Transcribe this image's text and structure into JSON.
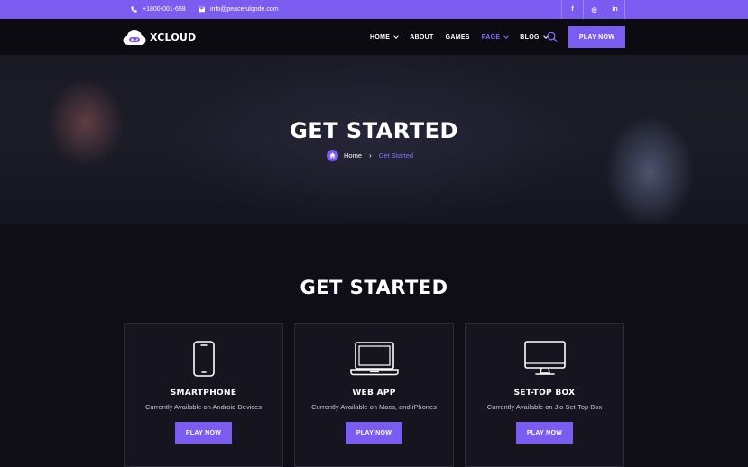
{
  "topbar": {
    "phone": "+1800-001-658",
    "email": "info@peacefulqode.com",
    "socials": [
      {
        "icon": "facebook-icon",
        "glyph": "f"
      },
      {
        "icon": "instagram-icon",
        "glyph": "◎"
      },
      {
        "icon": "linkedin-icon",
        "glyph": "in"
      }
    ]
  },
  "header": {
    "logo": "XCLOUD",
    "nav": [
      {
        "label": "HOME",
        "dropdown": true,
        "active": false
      },
      {
        "label": "ABOUT",
        "dropdown": false,
        "active": false
      },
      {
        "label": "GAMES",
        "dropdown": false,
        "active": false
      },
      {
        "label": "PAGE",
        "dropdown": true,
        "active": true
      },
      {
        "label": "BLOG",
        "dropdown": true,
        "active": false
      }
    ],
    "cta": "PLAY NOW"
  },
  "hero": {
    "title": "GET STARTED",
    "breadcrumb_home": "Home",
    "breadcrumb_current": "Get Started"
  },
  "section": {
    "title": "GET STARTED",
    "cards": [
      {
        "title": "SMARTPHONE",
        "desc": "Currently Available on Android Devices",
        "button": "PLAY NOW",
        "icon": "smartphone-icon"
      },
      {
        "title": "WEB APP",
        "desc": "Currently Available on Macs, and iPhones",
        "button": "PLAY NOW",
        "icon": "laptop-icon"
      },
      {
        "title": "SET-TOP BOX",
        "desc": "Currently Available on Jio Set-Top Box",
        "button": "PLAY NOW",
        "icon": "monitor-icon"
      }
    ]
  },
  "colors": {
    "accent": "#7b5cf0",
    "background": "#0f0e17",
    "card": "#16151f"
  }
}
